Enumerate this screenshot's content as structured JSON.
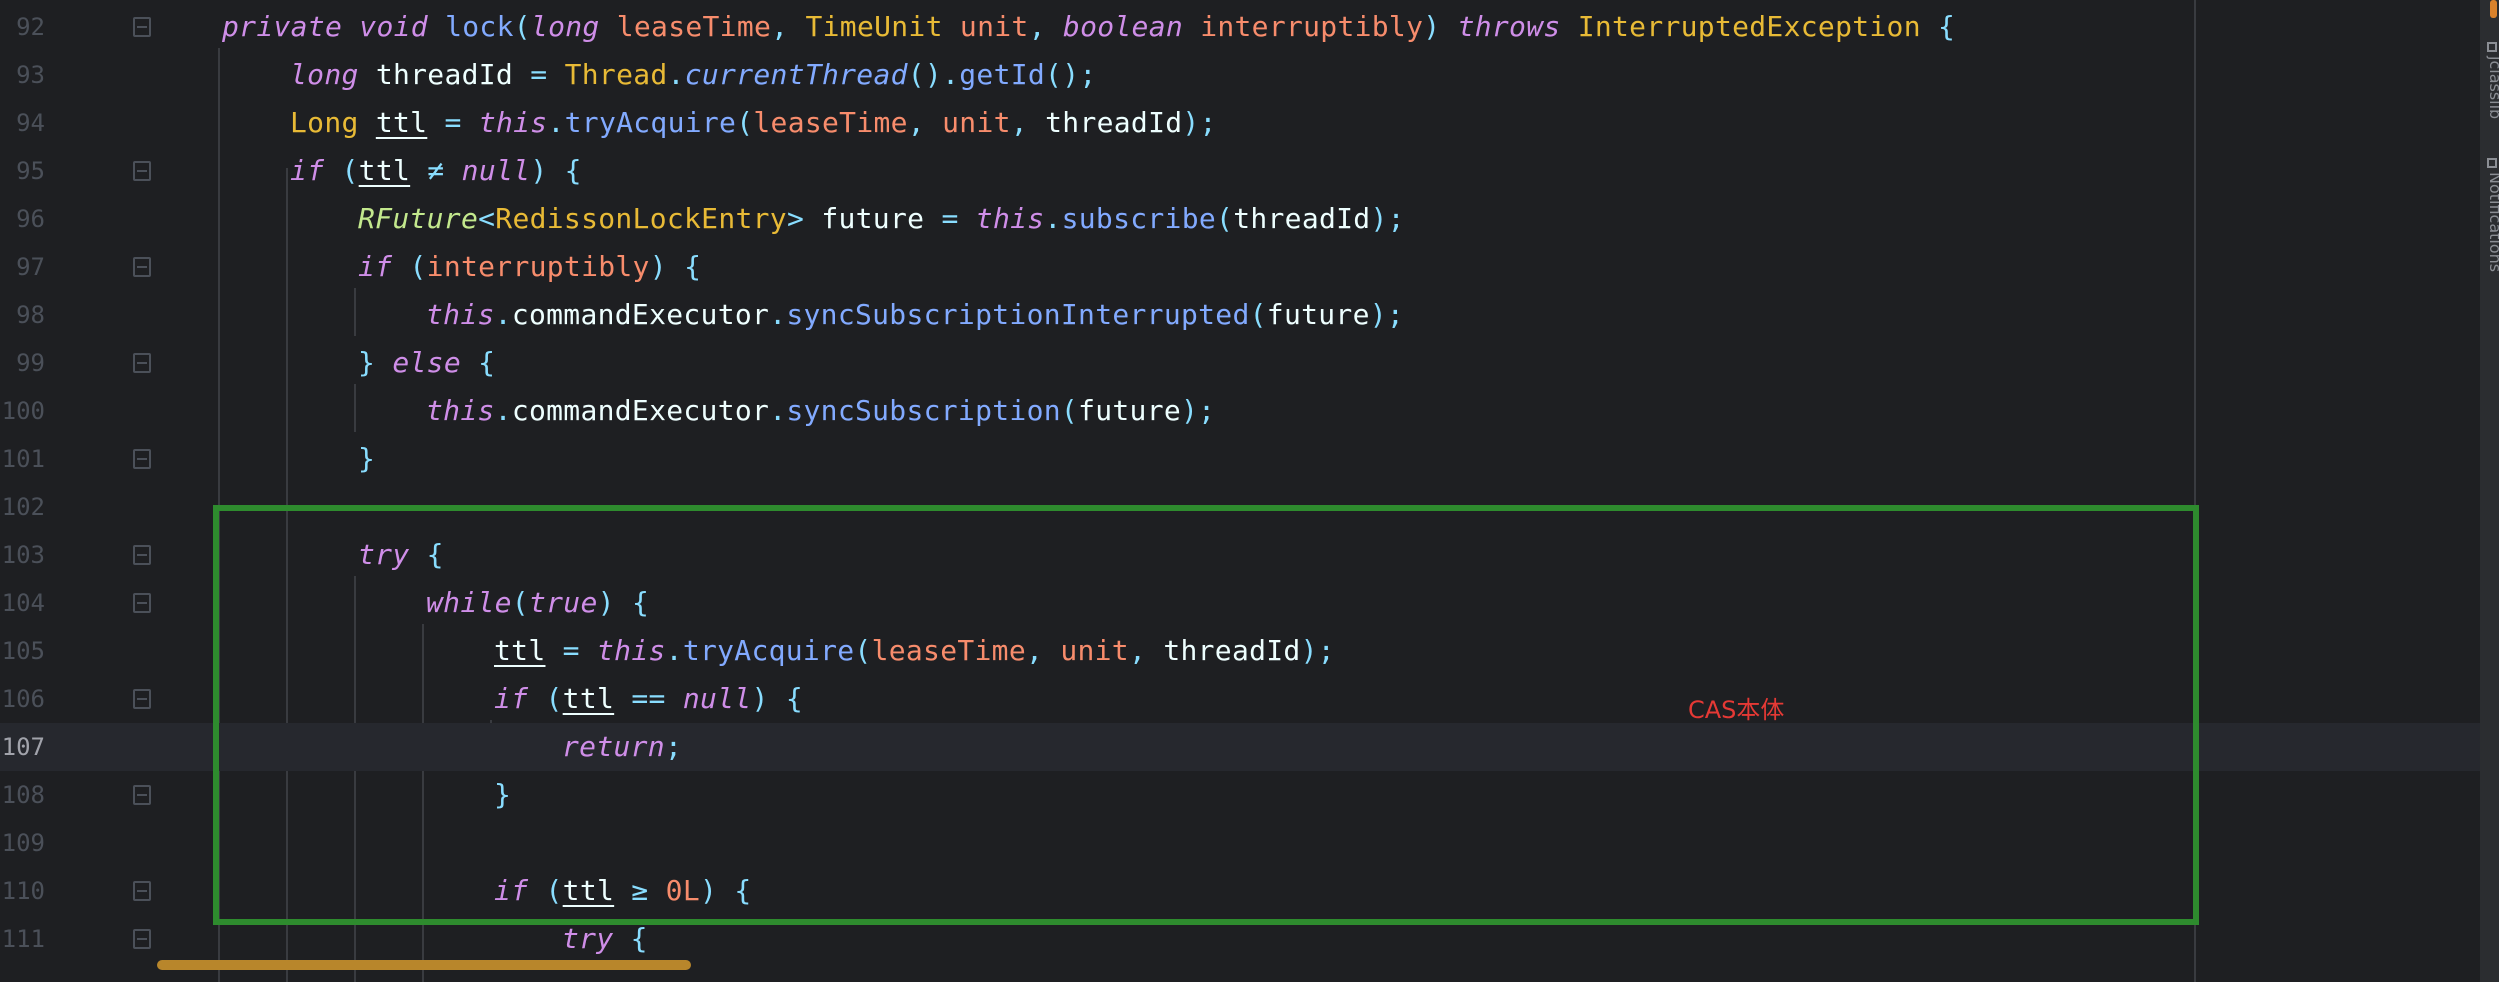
{
  "editor": {
    "current_line": "107",
    "lines": [
      {
        "n": "92"
      },
      {
        "n": "93"
      },
      {
        "n": "94"
      },
      {
        "n": "95"
      },
      {
        "n": "96"
      },
      {
        "n": "97"
      },
      {
        "n": "98"
      },
      {
        "n": "99"
      },
      {
        "n": "100"
      },
      {
        "n": "101"
      },
      {
        "n": "102"
      },
      {
        "n": "103"
      },
      {
        "n": "104"
      },
      {
        "n": "105"
      },
      {
        "n": "106"
      },
      {
        "n": "107"
      },
      {
        "n": "108"
      },
      {
        "n": "109"
      },
      {
        "n": "110"
      },
      {
        "n": "111"
      }
    ]
  },
  "annotation": {
    "text": "CAS本体",
    "color": "#e53935"
  },
  "highlight_box_color": "#2e8b2e",
  "side_tabs": [
    {
      "label": "jclasslib"
    },
    {
      "label": "Notifications"
    }
  ],
  "icons": [
    "fold-marker-icon",
    "jclasslib-icon",
    "notifications-icon"
  ],
  "colors": {
    "background": "#1e1f22",
    "keyword": "#cf8ee8",
    "type": "#e8ba36",
    "parameter": "#f78c6c",
    "method": "#82aaff",
    "punctuation": "#89ddff"
  }
}
